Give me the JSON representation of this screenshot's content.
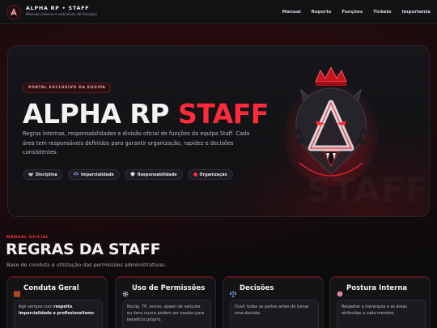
{
  "nav": {
    "title": "ALPHA RP • STAFF",
    "subtitle": "Manual interno e estrutura de funções",
    "links": [
      "Manual",
      "Reports",
      "Funções",
      "Tickets",
      "Importante"
    ]
  },
  "hero": {
    "badge": "PORTAL EXCLUSIVO DA EQUIPA",
    "title_main": "ALPHA RP",
    "title_accent": "STAFF",
    "description": "Regras internas, responsabilidades e divisão oficial de funções da equipa Staff. Cada área tem responsáveis definidos para garantir organização, rapidez e decisões consistentes.",
    "chips": [
      {
        "label": "Disciplina",
        "icon": "wolf-icon"
      },
      {
        "label": "Imparcialidade",
        "icon": "scales-icon"
      },
      {
        "label": "Responsabilidade",
        "icon": "shield-icon"
      },
      {
        "label": "Organização",
        "icon": "red-dot-icon"
      }
    ],
    "watermark": "STAFF"
  },
  "section": {
    "kicker": "MANUAL OFICIAL",
    "title": "REGRAS DA STAFF",
    "subtitle": "Base de conduta e utilização das permissões administrativas."
  },
  "cards": [
    {
      "title": "Conduta Geral",
      "icon": "brick-icon",
      "text_pre": "Agir sempre com ",
      "text_bold1": "respeito",
      "text_mid": ", ",
      "text_bold2": "imparcialidade e profissionalismo",
      "text_post": "."
    },
    {
      "title": "Uso de Permissões",
      "icon": "gear-icon",
      "text": "Noclip, TP, revive, spawn de veículos ou itens nunca podem ser usados para benefício próprio."
    },
    {
      "title": "Decisões",
      "icon": "scales-icon",
      "text": "Ouvir todas as partes antes de tomar uma decisão."
    },
    {
      "title": "Postura Interna",
      "icon": "brain-icon",
      "text": "Respeitar a hierarquia e as áreas atribuídas a cada membro."
    }
  ],
  "colors": {
    "accent": "#ff2a3a",
    "background": "#0b0b0d",
    "card": "#141417"
  }
}
